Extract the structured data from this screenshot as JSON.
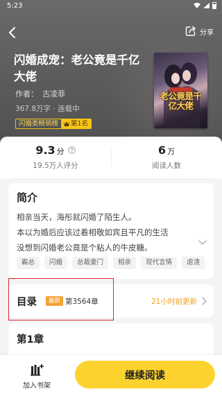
{
  "status": {
    "time": "5:23"
  },
  "header": {
    "share_label": "分享"
  },
  "book": {
    "title": "闪婚成宠：老公竟是千亿大佬",
    "author_label": "作者：",
    "author": "古凌菲",
    "meta": "367.8万字 · 连载中",
    "rank_list": "闪婚类畅销榜",
    "rank_position": "第1名",
    "cover_title": "老公竟是千亿大佬"
  },
  "stats": {
    "rating_value": "9.3",
    "rating_unit": "分",
    "rating_label": "19.5万人评分",
    "readers_value": "6",
    "readers_unit": "万",
    "readers_label": "阅读人数"
  },
  "intro": {
    "heading": "简介",
    "lines": [
      "相亲当天，海彤就闪婚了陌生人。",
      "本以为婚后应该过着相敬如宾且平凡的生活",
      "没想到闪婚老公竟是个粘人的牛皮糖。"
    ],
    "tags": [
      "霸总",
      "闪婚",
      "总裁豪门",
      "相亲",
      "现代言情",
      "虐渣"
    ]
  },
  "toc": {
    "heading": "目录",
    "badge": "最新",
    "latest_chapter": "第3564章",
    "updated": "21小时前更新"
  },
  "chapter": {
    "title": "第1章"
  },
  "bottom": {
    "shelf_label": "加入书架",
    "read_label": "继续阅读"
  },
  "colors": {
    "accent_yellow": "#fcd32e",
    "update_orange": "#f0a020",
    "badge_orange": "#f2a23a",
    "highlight_red": "#e0262b"
  }
}
